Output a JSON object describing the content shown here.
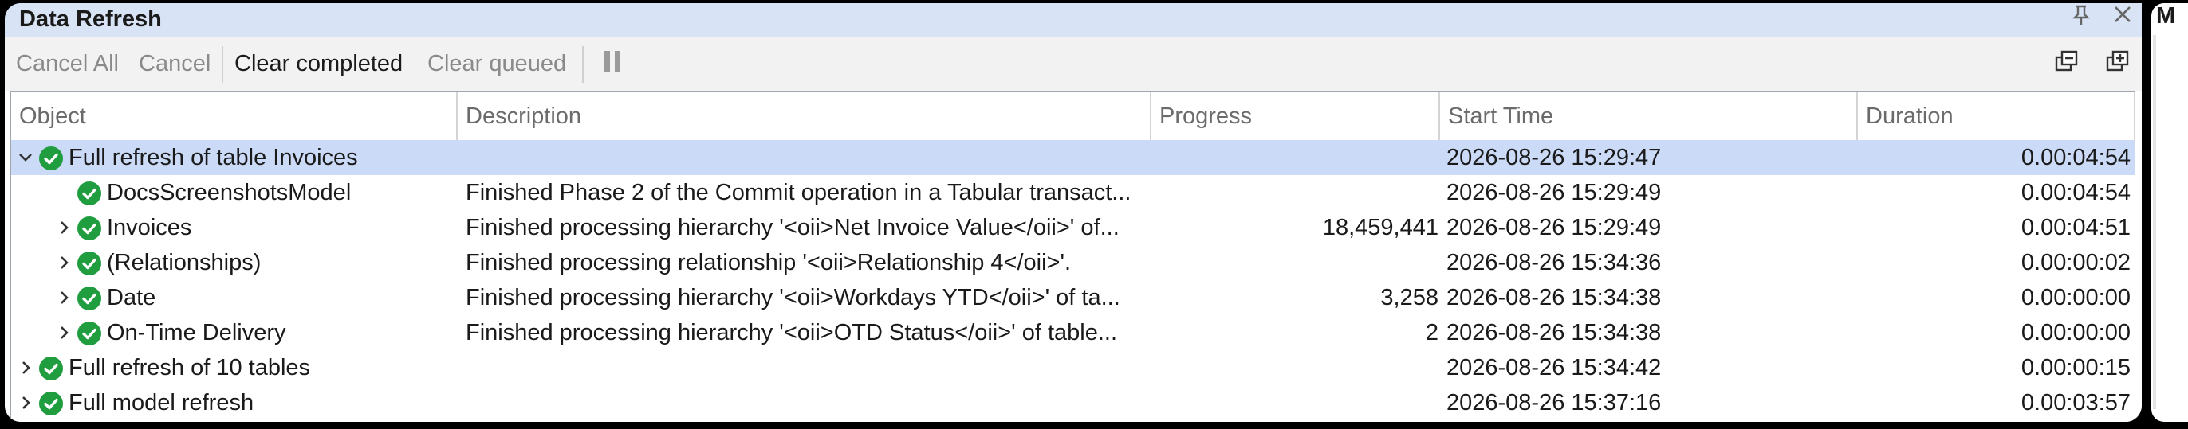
{
  "window": {
    "title": "Data Refresh",
    "side_title": "M"
  },
  "toolbar": {
    "cancel_all": "Cancel All",
    "cancel": "Cancel",
    "clear_completed": "Clear completed",
    "clear_queued": "Clear queued"
  },
  "columns": {
    "object": "Object",
    "description": "Description",
    "progress": "Progress",
    "start_time": "Start Time",
    "duration": "Duration"
  },
  "rows": [
    {
      "object": "Full refresh of table Invoices",
      "description": "",
      "progress": "",
      "start": "2026-08-26 15:29:47",
      "duration": "0.00:04:54",
      "level": 0,
      "expanded": true,
      "selected": true
    },
    {
      "object": "DocsScreenshotsModel",
      "description": "Finished Phase 2 of the Commit operation in a Tabular transact...",
      "progress": "",
      "start": "2026-08-26 15:29:49",
      "duration": "0.00:04:54",
      "level": 1,
      "expanded": null,
      "selected": false
    },
    {
      "object": "Invoices",
      "description": "Finished processing hierarchy '<oii>Net Invoice Value</oii>' of...",
      "progress": "18,459,441",
      "start": "2026-08-26 15:29:49",
      "duration": "0.00:04:51",
      "level": 1,
      "expanded": false,
      "selected": false
    },
    {
      "object": "(Relationships)",
      "description": "Finished processing relationship '<oii>Relationship 4</oii>'.",
      "progress": "",
      "start": "2026-08-26 15:34:36",
      "duration": "0.00:00:02",
      "level": 1,
      "expanded": false,
      "selected": false
    },
    {
      "object": "Date",
      "description": "Finished processing hierarchy '<oii>Workdays YTD</oii>' of ta...",
      "progress": "3,258",
      "start": "2026-08-26 15:34:38",
      "duration": "0.00:00:00",
      "level": 1,
      "expanded": false,
      "selected": false
    },
    {
      "object": "On-Time Delivery",
      "description": "Finished processing hierarchy '<oii>OTD Status</oii>' of table...",
      "progress": "2",
      "start": "2026-08-26 15:34:38",
      "duration": "0.00:00:00",
      "level": 1,
      "expanded": false,
      "selected": false
    },
    {
      "object": "Full refresh of 10 tables",
      "description": "",
      "progress": "",
      "start": "2026-08-26 15:34:42",
      "duration": "0.00:00:15",
      "level": 0,
      "expanded": false,
      "selected": false
    },
    {
      "object": "Full model refresh",
      "description": "",
      "progress": "",
      "start": "2026-08-26 15:37:16",
      "duration": "0.00:03:57",
      "level": 0,
      "expanded": false,
      "selected": false
    }
  ],
  "icons": {
    "status": "check-circle-icon",
    "expand": "chevron-right-icon",
    "collapse": "chevron-down-icon",
    "pause": "pause-icon",
    "pin": "pin-icon",
    "close": "close-icon"
  },
  "colors": {
    "selection": "#cbdaf6",
    "titlebar": "#d8e3f5",
    "success": "#1f9d3f"
  }
}
